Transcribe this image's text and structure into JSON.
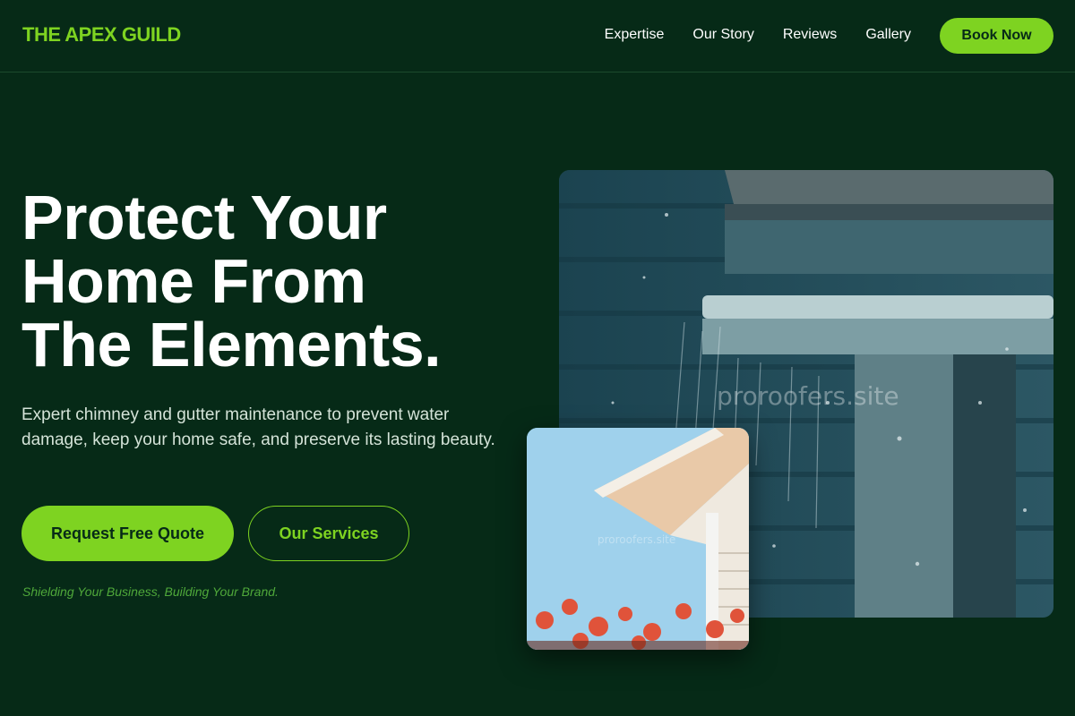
{
  "brand": {
    "logo": "THE APEX GUILD",
    "accent": "#7ed321",
    "background": "#062a17"
  },
  "nav": {
    "links": [
      "Expertise",
      "Our Story",
      "Reviews",
      "Gallery"
    ],
    "cta": "Book Now"
  },
  "hero": {
    "title_lines": [
      "Protect Your",
      "Home From",
      "The Elements."
    ],
    "subtitle": "Expert chimney and gutter maintenance to prevent water damage, keep your home safe, and preserve its lasting beauty.",
    "primary_button": "Request Free Quote",
    "secondary_button": "Our Services",
    "tagline": "Shielding Your Business, Building Your Brand."
  },
  "images": {
    "large": {
      "watermark": "proroofers.site"
    },
    "small": {
      "watermark": "proroofers.site"
    }
  }
}
